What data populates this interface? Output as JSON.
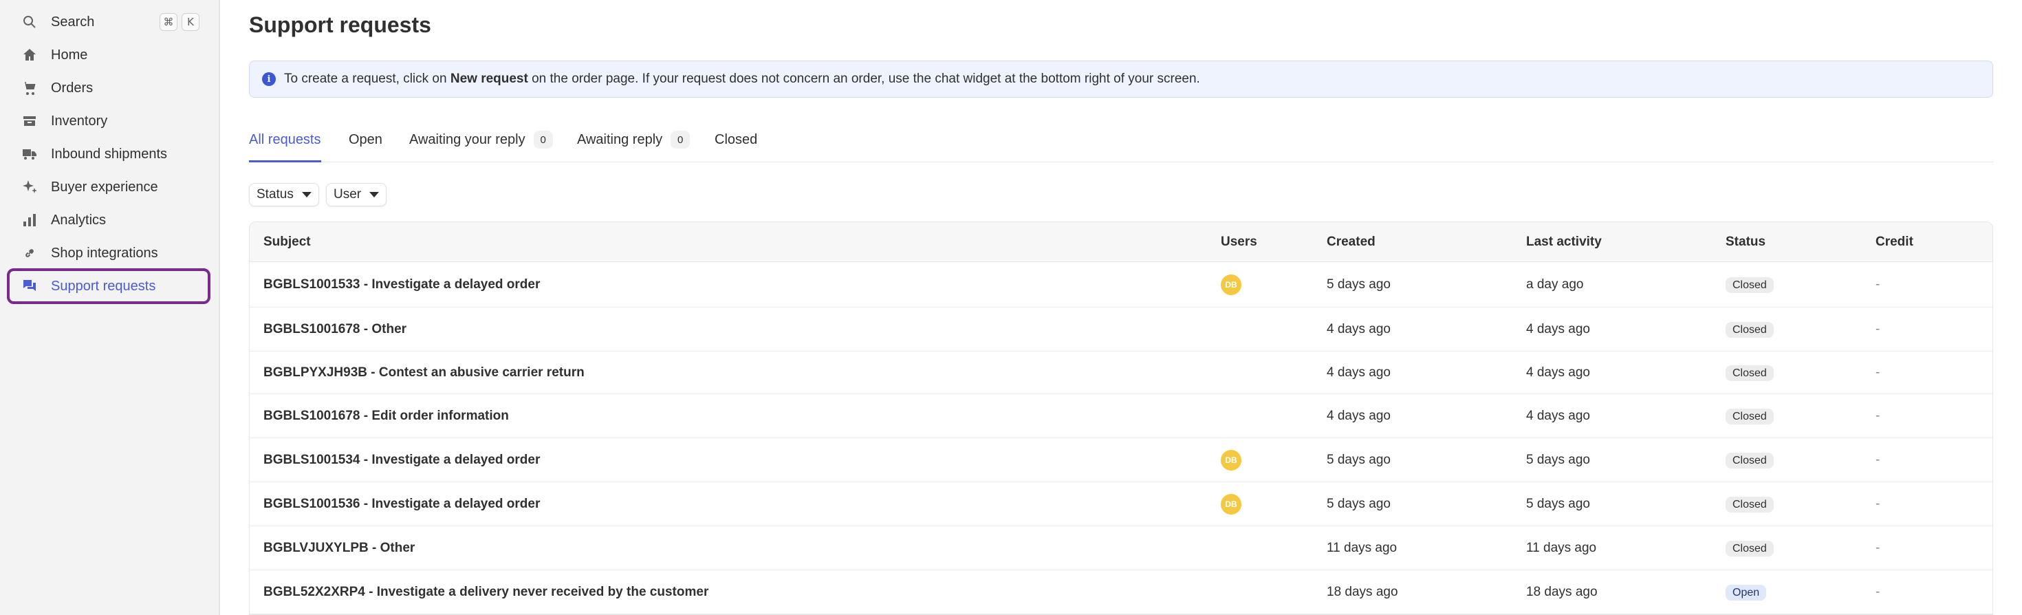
{
  "sidebar": {
    "search_label": "Search",
    "shortcut_cmd": "⌘",
    "shortcut_key": "K",
    "items": [
      {
        "label": "Home",
        "icon": "home-icon"
      },
      {
        "label": "Orders",
        "icon": "cart-icon"
      },
      {
        "label": "Inventory",
        "icon": "inventory-icon"
      },
      {
        "label": "Inbound shipments",
        "icon": "truck-icon"
      },
      {
        "label": "Buyer experience",
        "icon": "sparkle-icon"
      },
      {
        "label": "Analytics",
        "icon": "bar-chart-icon"
      },
      {
        "label": "Shop integrations",
        "icon": "link-icon"
      },
      {
        "label": "Support requests",
        "icon": "chat-icon",
        "active": true
      }
    ]
  },
  "page": {
    "title": "Support requests"
  },
  "banner": {
    "info_glyph": "i",
    "text_before": "To create a request, click on ",
    "text_bold": "New request",
    "text_after": " on the order page. If your request does not concern an order, use the chat widget at the bottom right of your screen."
  },
  "tabs": [
    {
      "label": "All requests",
      "active": true
    },
    {
      "label": "Open"
    },
    {
      "label": "Awaiting your reply",
      "count": "0"
    },
    {
      "label": "Awaiting reply",
      "count": "0"
    },
    {
      "label": "Closed"
    }
  ],
  "filters": {
    "status_label": "Status",
    "user_label": "User"
  },
  "table": {
    "headers": {
      "subject": "Subject",
      "users": "Users",
      "created": "Created",
      "last_activity": "Last activity",
      "status": "Status",
      "credit": "Credit"
    },
    "rows": [
      {
        "subject": "BGBLS1001533 - Investigate a delayed order",
        "user": "DB",
        "created": "5 days ago",
        "last_activity": "a day ago",
        "status": "Closed",
        "credit": "-"
      },
      {
        "subject": "BGBLS1001678 - Other",
        "user": "",
        "created": "4 days ago",
        "last_activity": "4 days ago",
        "status": "Closed",
        "credit": "-"
      },
      {
        "subject": "BGBLPYXJH93B - Contest an abusive carrier return",
        "user": "",
        "created": "4 days ago",
        "last_activity": "4 days ago",
        "status": "Closed",
        "credit": "-"
      },
      {
        "subject": "BGBLS1001678 - Edit order information",
        "user": "",
        "created": "4 days ago",
        "last_activity": "4 days ago",
        "status": "Closed",
        "credit": "-"
      },
      {
        "subject": "BGBLS1001534 - Investigate a delayed order",
        "user": "DB",
        "created": "5 days ago",
        "last_activity": "5 days ago",
        "status": "Closed",
        "credit": "-"
      },
      {
        "subject": "BGBLS1001536 - Investigate a delayed order",
        "user": "DB",
        "created": "5 days ago",
        "last_activity": "5 days ago",
        "status": "Closed",
        "credit": "-"
      },
      {
        "subject": "BGBLVJUXYLPB - Other",
        "user": "",
        "created": "11 days ago",
        "last_activity": "11 days ago",
        "status": "Closed",
        "credit": "-"
      },
      {
        "subject": "BGBL52X2XRP4 - Investigate a delivery never received by the customer",
        "user": "",
        "created": "18 days ago",
        "last_activity": "18 days ago",
        "status": "Open",
        "credit": "-"
      }
    ]
  },
  "colors": {
    "accent": "#4a5bd4",
    "highlight_ring": "#7b2a8c",
    "avatar": "#f5c842"
  }
}
